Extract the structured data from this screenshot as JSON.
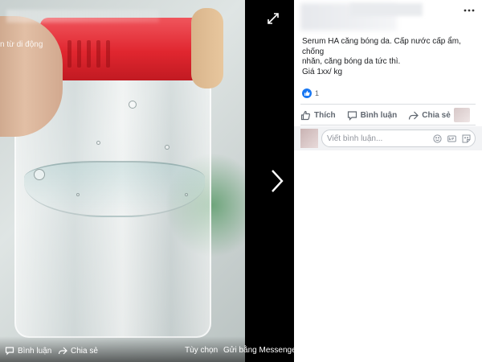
{
  "viewer": {
    "overlay_text": "n từ di động",
    "bottom_bar": {
      "comment_label": "Bình luận",
      "share_label": "Chia sẻ",
      "options_label": "Tùy chọn",
      "messenger_label": "Gửi bằng Messenger"
    }
  },
  "post": {
    "lines": [
      "Serum HA căng bóng da. Cấp nước cấp ẩm, chống",
      "nhăn, căng bóng da tức thì.",
      "Giá 1xx/ kg"
    ],
    "reaction_count": "1",
    "actions": {
      "like_label": "Thích",
      "comment_label": "Bình luận",
      "share_label": "Chia sẻ"
    },
    "comment_placeholder": "Viết bình luận..."
  },
  "colors": {
    "facebook_blue": "#1877f2",
    "cap_red": "#e0262f"
  },
  "icons": [
    "expand-icon",
    "next-arrow-icon",
    "more-icon",
    "like-icon",
    "comment-icon",
    "share-icon",
    "emoji-icon",
    "gif-icon",
    "sticker-icon"
  ]
}
